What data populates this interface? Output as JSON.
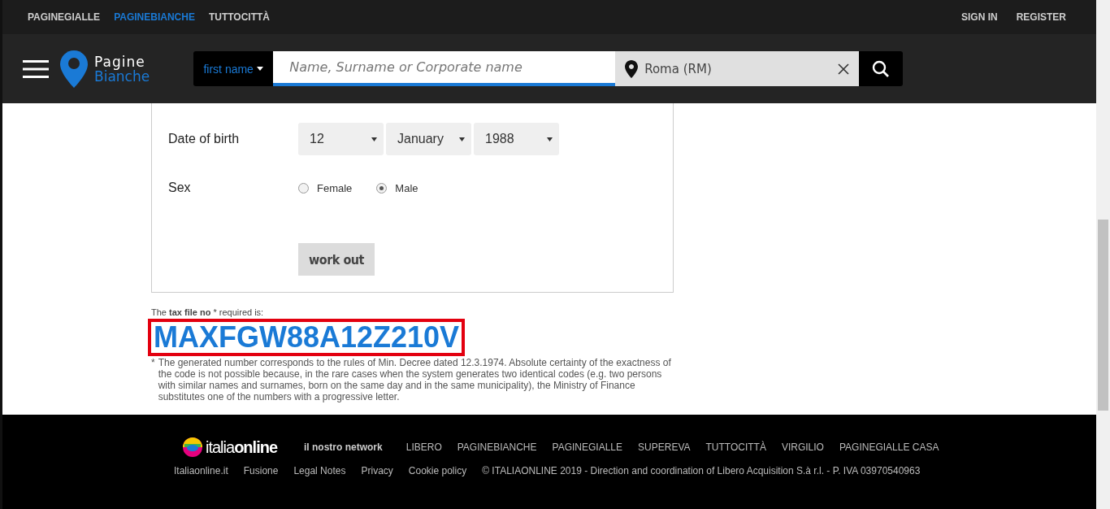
{
  "top_nav": {
    "left": [
      {
        "label": "PAGINEGIALLE",
        "selected": false
      },
      {
        "label": "PAGINEBIANCHE",
        "selected": true
      },
      {
        "label": "TUTTOCITTÀ",
        "selected": false
      }
    ],
    "right": [
      "SIGN IN",
      "REGISTER"
    ]
  },
  "header": {
    "logo": {
      "line_1": "Pagine",
      "line_2": "Bianche"
    },
    "search_type": "first name",
    "search": {
      "placeholder": "Name, Surname or Corporate name"
    },
    "location": {
      "value": "Roma (RM)"
    }
  },
  "form": {
    "date_of_birth": {
      "label": "Date of birth",
      "selects": [
        "12",
        "January",
        "1988"
      ]
    },
    "sex": {
      "label": "Sex",
      "options": [
        {
          "label": "Female",
          "selected": false
        },
        {
          "label": "Male",
          "selected": true
        }
      ]
    },
    "button": "work out"
  },
  "result": {
    "intro": "The **tax file no** * required is:",
    "code": "MAXFGW88A12Z210V",
    "highlighted": true,
    "note_mark": "*",
    "note": "The generated number corresponds to the rules of Min. Decree dated 12.3.1974. Absolute certainty of the exactness of the code is not possible because, in the rare cases when the system generates two identical codes (e.g. two persons with similar names and surnames, born on the same day and in the same municipality), the Ministry of Finance substitutes one of the numbers with a progressive letter."
  },
  "footer": {
    "brand": {
      "part_1": "italia",
      "part_2": "online"
    },
    "network_label": "il nostro network",
    "network": [
      "LIBERO",
      "PAGINEBIANCHE",
      "PAGINEGIALLE",
      "SUPEREVA",
      "TUTTOCITTÀ",
      "VIRGILIO",
      "PAGINEGIALLE CASA"
    ],
    "links": [
      "Italiaonline.it",
      "Fusione",
      "Legal Notes",
      "Privacy",
      "Cookie policy"
    ],
    "copyright": "© ITALIAONLINE 2019 - Direction and coordination of Libero Acquisition S.à r.l. - P. IVA 03970540963"
  }
}
